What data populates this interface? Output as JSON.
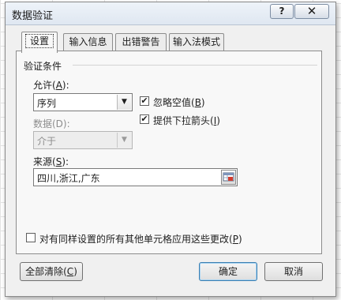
{
  "window": {
    "title": "数据验证",
    "help_label": "?",
    "close_label": "✕"
  },
  "tabs": [
    {
      "label": "设置",
      "active": true
    },
    {
      "label": "输入信息",
      "active": false
    },
    {
      "label": "出错警告",
      "active": false
    },
    {
      "label": "输入法模式",
      "active": false
    }
  ],
  "settings": {
    "group_title": "验证条件",
    "allow": {
      "label_prefix": "允许(",
      "accel": "A",
      "label_suffix": "):",
      "value": "序列"
    },
    "data": {
      "label": "数据(D):",
      "value": "介于"
    },
    "ignore_blank": {
      "label_prefix": "忽略空值(",
      "accel": "B",
      "label_suffix": ")",
      "checked": true,
      "mark": "✔"
    },
    "in_cell_dropdown": {
      "label_prefix": "提供下拉箭头(",
      "accel": "I",
      "label_suffix": ")",
      "checked": true,
      "mark": "✔"
    },
    "source": {
      "label_prefix": "来源(",
      "accel": "S",
      "label_suffix": "):",
      "value": "四川,浙江,广东"
    },
    "apply_all": {
      "label_prefix": "对有同样设置的所有其他单元格应用这些更改(",
      "accel": "P",
      "label_suffix": ")",
      "checked": false
    }
  },
  "buttons": {
    "clear_all": {
      "prefix": "全部清除(",
      "accel": "C",
      "suffix": ")"
    },
    "ok": "确定",
    "cancel": "取消"
  },
  "icons": {
    "dropdown_arrow": "▼",
    "range_selector": "range-selector-icon"
  }
}
